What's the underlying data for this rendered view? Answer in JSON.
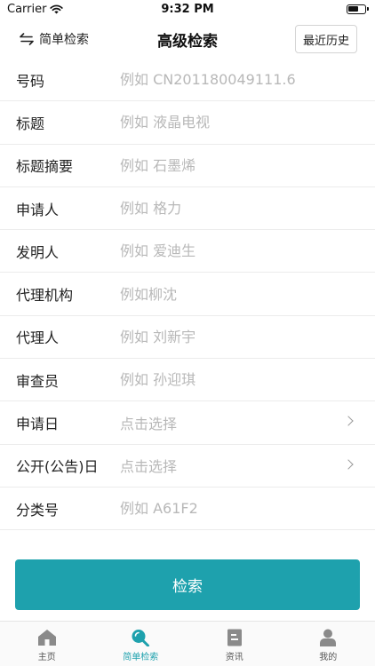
{
  "status_bar": {
    "carrier": "Carrier",
    "time": "9:32 PM"
  },
  "nav": {
    "left_label": "简单检索",
    "title": "高级检索",
    "right_label": "最近历史"
  },
  "form": {
    "number": {
      "label": "号码",
      "placeholder": "例如 CN201180049111.6"
    },
    "title": {
      "label": "标题",
      "placeholder": "例如 液晶电视"
    },
    "abstract": {
      "label": "标题摘要",
      "placeholder": "例如 石墨烯"
    },
    "applicant": {
      "label": "申请人",
      "placeholder": "例如 格力"
    },
    "inventor": {
      "label": "发明人",
      "placeholder": "例如 爱迪生"
    },
    "agency": {
      "label": "代理机构",
      "placeholder": "例如柳沈"
    },
    "agent": {
      "label": "代理人",
      "placeholder": "例如 刘新宇"
    },
    "examiner": {
      "label": "审查员",
      "placeholder": "例如 孙迎琪"
    },
    "apply_date": {
      "label": "申请日",
      "value": "点击选择"
    },
    "publish_date": {
      "label": "公开(公告)日",
      "value": "点击选择"
    },
    "classification": {
      "label": "分类号",
      "placeholder": "例如 A61F2"
    }
  },
  "search_button": "检索",
  "tabs": [
    {
      "label": "主页",
      "icon": "home-icon",
      "active": false
    },
    {
      "label": "简单检索",
      "icon": "search-icon",
      "active": true
    },
    {
      "label": "资讯",
      "icon": "news-icon",
      "active": false
    },
    {
      "label": "我的",
      "icon": "person-icon",
      "active": false
    }
  ],
  "colors": {
    "accent": "#1ea1ad",
    "tab_inactive": "#8a8a8a"
  }
}
